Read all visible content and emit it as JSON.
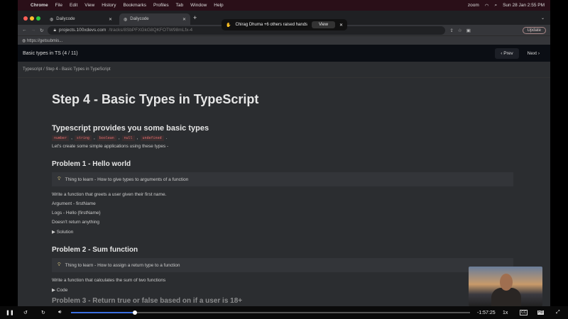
{
  "menubar": {
    "app": "Chrome",
    "items": [
      "File",
      "Edit",
      "View",
      "History",
      "Bookmarks",
      "Profiles",
      "Tab",
      "Window",
      "Help"
    ],
    "status": [
      "zoom"
    ],
    "datetime": "Sun 28 Jan  2:55 PM"
  },
  "tabs": [
    {
      "label": "Dailycode",
      "active": false
    },
    {
      "label": "Dailycode",
      "active": true
    }
  ],
  "toast": {
    "text": "Chirag Dhuma +6 others raised hands",
    "view": "View"
  },
  "address": {
    "host": "projects.100xdevs.com",
    "path": "/tracks/8SbPFXGkG8QKFOTW98mLfx-4",
    "update": "Update"
  },
  "bookmarks": [
    "https://getsubmis..."
  ],
  "page": {
    "header_title": "Basic types in TS (4 / 11)",
    "prev": "Prev",
    "next": "Next",
    "breadcrumb": [
      "Typescript",
      "Step 4 - Basic Types in TypeScript"
    ]
  },
  "content": {
    "title": "Step 4 - Basic Types in TypeScript",
    "intro_heading": "Typescript provides you some basic types",
    "types": [
      "number",
      "string",
      "boolean",
      "null",
      "undefined"
    ],
    "intro_text": "Let's create some simple applications using these types -",
    "problems": [
      {
        "title": "Problem 1 - Hello world",
        "learn": "Thing to learn - How to give types to arguments of a function",
        "lines": [
          "Write a function that greets a user given their first name.",
          "Argument - firstName",
          "Logs - Hello {firstName}",
          "Doesn't return anything"
        ],
        "toggle": "▶ Solution"
      },
      {
        "title": "Problem 2 - Sum function",
        "learn": "Thing to learn - How to assign a return type to a function",
        "lines": [
          "Write a function that calculates the sum of two functions"
        ],
        "toggle": "▶ Code"
      }
    ],
    "partial_heading": "Problem 3 - Return true or false based on if a user is 18+"
  },
  "player": {
    "remaining": "-1:57:25",
    "speed": "1x",
    "cc": "CC",
    "hd": "HD",
    "progress": 0.16
  }
}
